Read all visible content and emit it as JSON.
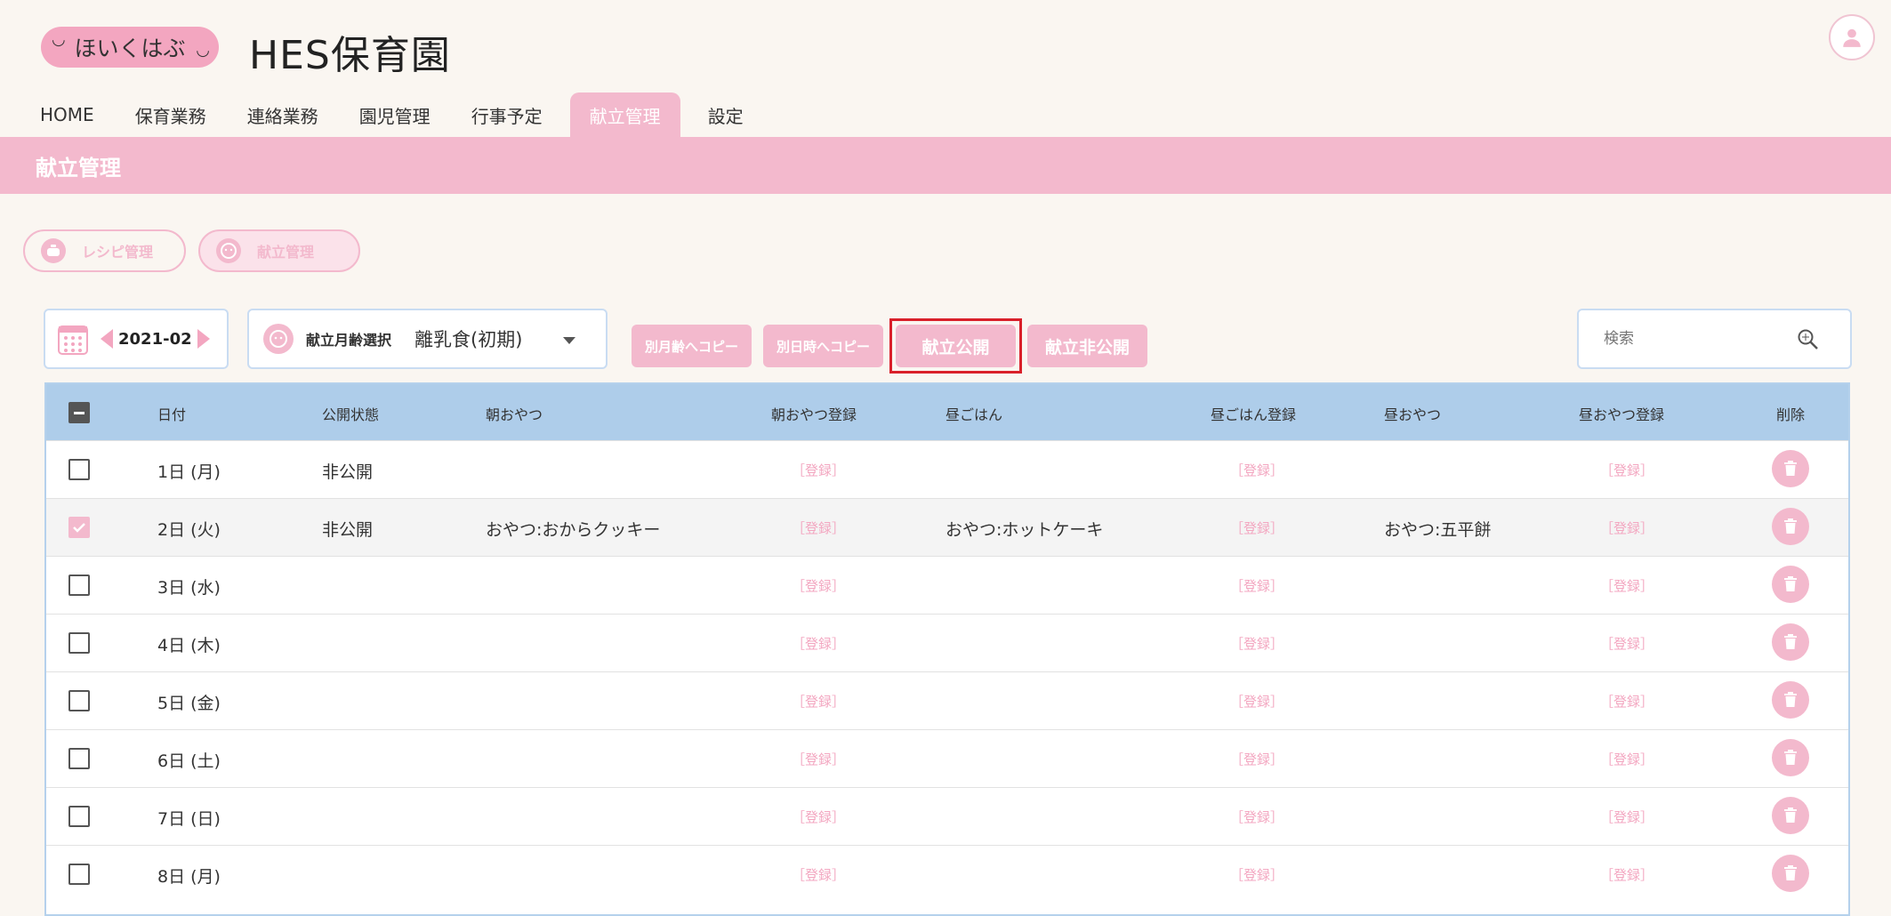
{
  "header": {
    "logo_text": "ほいくはぶ",
    "app_title": "HES保育園"
  },
  "nav": {
    "items": [
      {
        "label": "HOME",
        "active": false
      },
      {
        "label": "保育業務",
        "active": false
      },
      {
        "label": "連絡業務",
        "active": false
      },
      {
        "label": "園児管理",
        "active": false
      },
      {
        "label": "行事予定",
        "active": false
      },
      {
        "label": "献立管理",
        "active": true
      },
      {
        "label": "設定",
        "active": false
      }
    ]
  },
  "page_title": "献立管理",
  "subtabs": {
    "recipe": "レシピ管理",
    "menu": "献立管理"
  },
  "toolbar": {
    "month": "2021-02",
    "age_label": "献立月齢選択",
    "age_value": "離乳食(初期)",
    "copy_age": "別月齢へコピー",
    "copy_date": "別日時へコピー",
    "publish": "献立公開",
    "unpublish": "献立非公開",
    "search_placeholder": "検索"
  },
  "table": {
    "headers": [
      "日付",
      "公開状態",
      "朝おやつ",
      "朝おやつ登録",
      "昼ごはん",
      "昼ごはん登録",
      "昼おやつ",
      "昼おやつ登録",
      "削除"
    ],
    "register_label": "［登録］",
    "rows": [
      {
        "date": "1日 (月)",
        "status": "非公開",
        "am_snack": "",
        "lunch": "",
        "pm_snack": "",
        "checked": false
      },
      {
        "date": "2日 (火)",
        "status": "非公開",
        "am_snack": "おやつ:おからクッキー",
        "lunch": "おやつ:ホットケーキ",
        "pm_snack": "おやつ:五平餅",
        "checked": true
      },
      {
        "date": "3日 (水)",
        "status": "",
        "am_snack": "",
        "lunch": "",
        "pm_snack": "",
        "checked": false
      },
      {
        "date": "4日 (木)",
        "status": "",
        "am_snack": "",
        "lunch": "",
        "pm_snack": "",
        "checked": false
      },
      {
        "date": "5日 (金)",
        "status": "",
        "am_snack": "",
        "lunch": "",
        "pm_snack": "",
        "checked": false
      },
      {
        "date": "6日 (土)",
        "status": "",
        "am_snack": "",
        "lunch": "",
        "pm_snack": "",
        "checked": false
      },
      {
        "date": "7日 (日)",
        "status": "",
        "am_snack": "",
        "lunch": "",
        "pm_snack": "",
        "checked": false
      },
      {
        "date": "8日 (月)",
        "status": "",
        "am_snack": "",
        "lunch": "",
        "pm_snack": "",
        "checked": false
      }
    ]
  },
  "colors": {
    "accent_pink": "#f3b9cd",
    "header_blue": "#aecdea",
    "highlight_red": "#d9202a"
  }
}
